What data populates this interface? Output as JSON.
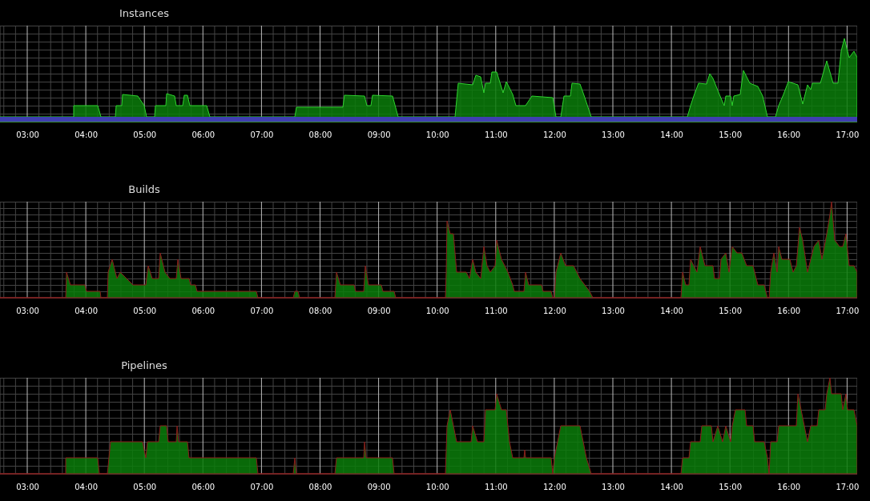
{
  "panels": [
    {
      "title": "Instances",
      "time_labels": [
        "03:00",
        "04:00",
        "05:00",
        "06:00",
        "07:00",
        "08:00",
        "09:00",
        "10:00",
        "11:00",
        "12:00",
        "13:00",
        "14:00",
        "15:00",
        "16:00",
        "17:00"
      ]
    },
    {
      "title": "Builds",
      "time_labels": [
        "03:00",
        "04:00",
        "05:00",
        "06:00",
        "07:00",
        "08:00",
        "09:00",
        "10:00",
        "11:00",
        "12:00",
        "13:00",
        "14:00",
        "15:00",
        "16:00",
        "17:00"
      ]
    },
    {
      "title": "Pipelines",
      "time_labels": [
        "03:00",
        "04:00",
        "05:00",
        "06:00",
        "07:00",
        "08:00",
        "09:00",
        "10:00",
        "11:00",
        "12:00",
        "13:00",
        "14:00",
        "15:00",
        "16:00",
        "17:00"
      ]
    }
  ]
}
